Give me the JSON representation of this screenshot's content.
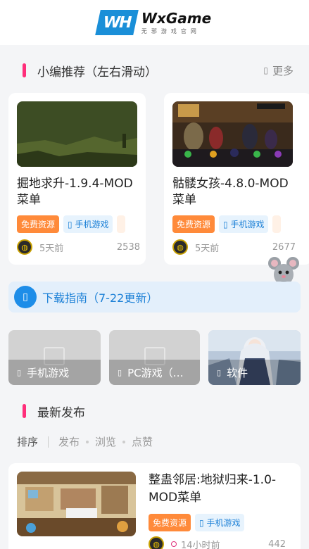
{
  "header": {
    "logo_mark": "WH",
    "logo_title": "WxGame",
    "logo_subtitle": "无邪游戏官网"
  },
  "featured": {
    "title": "小编推荐（左右滑动）",
    "more_icon": "▯",
    "more_label": "更多",
    "cards": [
      {
        "title": "掘地求升-1.9.4-MOD菜单",
        "tag_free": "免费资源",
        "tag_mobile": "手机游戏",
        "tag_icon": "▯",
        "time": "5天前",
        "views": "2538"
      },
      {
        "title": "骷髅女孩-4.8.0-MOD菜单",
        "tag_free": "免费资源",
        "tag_mobile": "手机游戏",
        "tag_icon": "▯",
        "time": "5天前",
        "views": "2677"
      }
    ]
  },
  "guide": {
    "icon": "▯",
    "text": "下载指南（7-22更新）"
  },
  "categories": [
    {
      "icon": "▯",
      "label": "手机游戏"
    },
    {
      "icon": "▯",
      "label": "PC游戏（…"
    },
    {
      "icon": "▯",
      "label": "软件"
    }
  ],
  "latest": {
    "title": "最新发布",
    "sort": [
      "排序",
      "发布",
      "浏览",
      "点赞"
    ],
    "items": [
      {
        "title": "整蛊邻居:地狱归来-1.0-MOD菜单",
        "tag_free": "免费资源",
        "tag_mobile": "手机游戏",
        "tag_icon": "▯",
        "time": "14小时前",
        "views": "442"
      }
    ]
  },
  "colors": {
    "accent_pink": "#ff2e7a",
    "brand_blue": "#1a8fd8",
    "tag_orange": "#ff8a3a"
  }
}
